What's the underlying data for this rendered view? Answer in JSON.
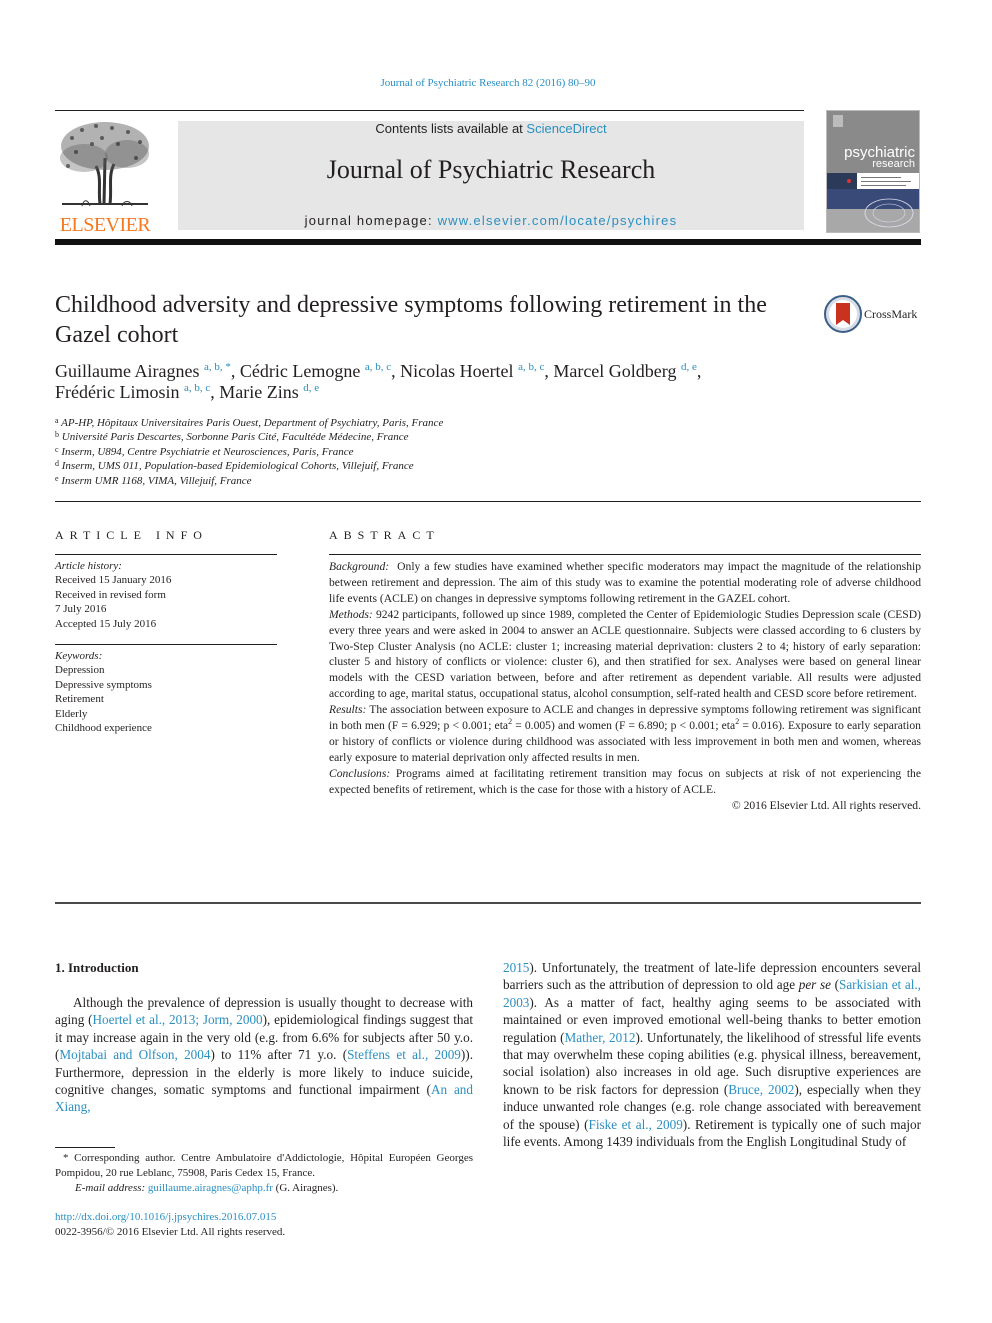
{
  "header": {
    "citation": "Journal of Psychiatric Research 82 (2016) 80–90",
    "contents_prefix": "Contents lists available at ",
    "contents_link": "ScienceDirect",
    "journal_name": "Journal of Psychiatric Research",
    "homepage_prefix": "journal homepage: ",
    "homepage_link": "www.elsevier.com/locate/psychires",
    "publisher_logo_text": "ELSEVIER",
    "cover_title_line1": "psychiatric",
    "cover_title_line2": "research",
    "crossmark_label": "CrossMark"
  },
  "colors": {
    "link": "#2a8fc1",
    "elsevier_orange": "#f47920",
    "banner_bg": "#e6e6e6",
    "text": "#231f20"
  },
  "article": {
    "title": "Childhood adversity and depressive symptoms following retirement in the Gazel cohort",
    "authors": [
      {
        "name": "Guillaume Airagnes",
        "affil": "a, b, *"
      },
      {
        "name": "Cédric Lemogne",
        "affil": "a, b, c"
      },
      {
        "name": "Nicolas Hoertel",
        "affil": "a, b, c"
      },
      {
        "name": "Marcel Goldberg",
        "affil": "d, e"
      },
      {
        "name": "Frédéric Limosin",
        "affil": "a, b, c"
      },
      {
        "name": "Marie Zins",
        "affil": "d, e"
      }
    ],
    "affiliations": [
      {
        "key": "a",
        "text": "AP-HP, Hôpitaux Universitaires Paris Ouest, Department of Psychiatry, Paris, France"
      },
      {
        "key": "b",
        "text": "Université Paris Descartes, Sorbonne Paris Cité, Facultéde Médecine, France"
      },
      {
        "key": "c",
        "text": "Inserm, U894, Centre Psychiatrie et Neurosciences, Paris, France"
      },
      {
        "key": "d",
        "text": "Inserm, UMS 011, Population-based Epidemiological Cohorts, Villejuif, France"
      },
      {
        "key": "e",
        "text": "Inserm UMR 1168, VIMA, Villejuif, France"
      }
    ]
  },
  "article_info": {
    "heading": "ARTICLE INFO",
    "history_label": "Article history:",
    "history": [
      "Received 15 January 2016",
      "Received in revised form",
      "7 July 2016",
      "Accepted 15 July 2016"
    ],
    "keywords_label": "Keywords:",
    "keywords": [
      "Depression",
      "Depressive symptoms",
      "Retirement",
      "Elderly",
      "Childhood experience"
    ]
  },
  "abstract": {
    "heading": "ABSTRACT",
    "background_label": "Background:",
    "background": "Only a few studies have examined whether specific moderators may impact the magnitude of the relationship between retirement and depression. The aim of this study was to examine the potential moderating role of adverse childhood life events (ACLE) on changes in depressive symptoms following retirement in the GAZEL cohort.",
    "methods_label": "Methods:",
    "methods": "9242 participants, followed up since 1989, completed the Center of Epidemiologic Studies Depression scale (CESD) every three years and were asked in 2004 to answer an ACLE questionnaire. Subjects were classed according to 6 clusters by Two-Step Cluster Analysis (no ACLE: cluster 1; increasing material deprivation: clusters 2 to 4; history of early separation: cluster 5 and history of conflicts or violence: cluster 6), and then stratified for sex. Analyses were based on general linear models with the CESD variation between, before and after retirement as dependent variable. All results were adjusted according to age, marital status, occupational status, alcohol consumption, self-rated health and CESD score before retirement.",
    "results_label": "Results:",
    "results_part1": "The association between exposure to ACLE and changes in depressive symptoms following retirement was significant in both men (F = 6.929; p < 0.001; eta",
    "results_part2": " = 0.005) and women (F = 6.890; p < 0.001; eta",
    "results_part3": " = 0.016). Exposure to early separation or history of conflicts or violence during childhood was associated with less improvement in both men and women, whereas early exposure to material deprivation only affected results in men.",
    "superscript": "2",
    "conclusions_label": "Conclusions:",
    "conclusions": "Programs aimed at facilitating retirement transition may focus on subjects at risk of not experiencing the expected benefits of retirement, which is the case for those with a history of ACLE.",
    "copyright": "© 2016 Elsevier Ltd. All rights reserved."
  },
  "intro": {
    "heading": "1.  Introduction",
    "col1": [
      {
        "t": "Although the prevalence of depression is usually thought to decrease with aging ("
      },
      {
        "t": "Hoertel et al., 2013; Jorm, 2000",
        "link": true
      },
      {
        "t": "), epidemiological findings suggest that it may increase again in the very old (e.g. from 6.6% for subjects after 50 y.o. ("
      },
      {
        "t": "Mojtabai and Olfson, 2004",
        "link": true
      },
      {
        "t": ") to 11% after 71 y.o. ("
      },
      {
        "t": "Steffens et al., 2009",
        "link": true
      },
      {
        "t": ")). Furthermore, depression in the elderly is more likely to induce suicide, cognitive changes, somatic symptoms and functional impairment ("
      },
      {
        "t": "An and Xiang,",
        "link": true
      }
    ],
    "col2": [
      {
        "t": "2015",
        "link": true
      },
      {
        "t": "). Unfortunately, the treatment of late-life depression encounters several barriers such as the attribution of depression to old age "
      },
      {
        "t": "per se",
        "italic": true
      },
      {
        "t": " ("
      },
      {
        "t": "Sarkisian et al., 2003",
        "link": true
      },
      {
        "t": "). As a matter of fact, healthy aging seems to be associated with maintained or even improved emotional well-being thanks to better emotion regulation ("
      },
      {
        "t": "Mather, 2012",
        "link": true
      },
      {
        "t": "). Unfortunately, the likelihood of stressful life events that may overwhelm these coping abilities (e.g. physical illness, bereavement, social isolation) also increases in old age. Such disruptive experiences are known to be risk factors for depression ("
      },
      {
        "t": "Bruce, 2002",
        "link": true
      },
      {
        "t": "), especially when they induce unwanted role changes (e.g. role change associated with bereavement of the spouse) ("
      },
      {
        "t": "Fiske et al., 2009",
        "link": true
      },
      {
        "t": "). Retirement is typically one of such major life events. Among 1439 individuals from the English Longitudinal Study of"
      }
    ]
  },
  "footnote": {
    "corresponding": "* Corresponding author. Centre Ambulatoire d'Addictologie, Hôpital Européen Georges Pompidou, 20 rue Leblanc, 75908, Paris Cedex 15, France.",
    "email_label": "E-mail address:",
    "email": "guillaume.airagnes@aphp.fr",
    "email_suffix": " (G. Airagnes).",
    "doi": "http://dx.doi.org/10.1016/j.jpsychires.2016.07.015",
    "issn": "0022-3956/© 2016 Elsevier Ltd. All rights reserved."
  }
}
